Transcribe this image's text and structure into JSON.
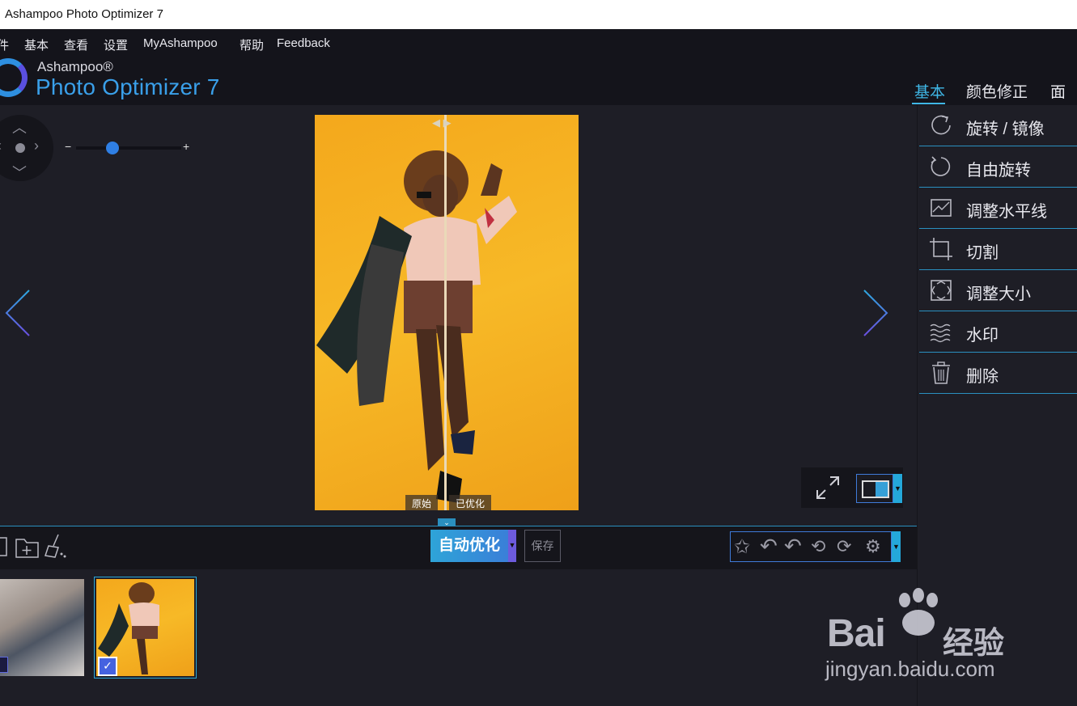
{
  "window": {
    "title": "Ashampoo Photo Optimizer 7"
  },
  "menu": [
    "件",
    "基本",
    "查看",
    "设置",
    "MyAshampoo",
    "帮助",
    "Feedback"
  ],
  "brand": {
    "small": "Ashampoo®",
    "big": "Photo Optimizer 7"
  },
  "tabs": [
    {
      "label": "基本",
      "active": true
    },
    {
      "label": "颜色修正",
      "active": false
    },
    {
      "label": "面部",
      "active": false
    }
  ],
  "zoom": {
    "minus": "−",
    "plus": "+"
  },
  "compare": {
    "original_label": "原始",
    "optimized_label": "已优化",
    "split_fraction": 0.5
  },
  "toolbar": {
    "auto_label": "自动优化",
    "save_label": "保存"
  },
  "panel_items": [
    {
      "label": "旋转 / 镜像",
      "icon": "rotate-mirror-icon"
    },
    {
      "label": "自由旋转",
      "icon": "free-rotate-icon"
    },
    {
      "label": "调整水平线",
      "icon": "horizon-icon"
    },
    {
      "label": "切割",
      "icon": "crop-icon"
    },
    {
      "label": "调整大小",
      "icon": "resize-icon"
    },
    {
      "label": "水印",
      "icon": "watermark-icon"
    },
    {
      "label": "删除",
      "icon": "trash-icon"
    }
  ],
  "thumbnails": [
    {
      "name": "notebooks-photo",
      "selected": false
    },
    {
      "name": "dancer-photo",
      "selected": true
    }
  ],
  "watermark": {
    "brand": "Bai",
    "suffix": "经验",
    "url": "jingyan.baidu.com"
  },
  "colors": {
    "accent": "#3fb7e6",
    "background": "#1e1e26",
    "dark": "#15151b"
  }
}
